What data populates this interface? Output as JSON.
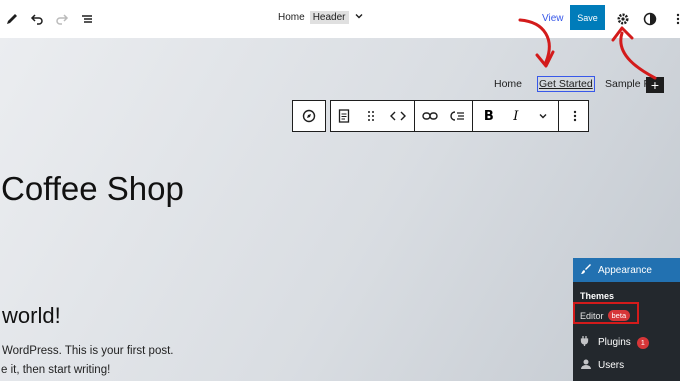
{
  "topbar": {
    "breadcrumb_page": "Home",
    "breadcrumb_template": "Header",
    "view_label": "View",
    "save_label": "Save"
  },
  "navigation": {
    "items": [
      "Home",
      "Get Started",
      "Sample P"
    ],
    "selected_index": 1
  },
  "site": {
    "title": "Coffee Shop"
  },
  "post": {
    "title": "world!",
    "line1": "WordPress. This is your first post.",
    "line2": "e it, then start writing!"
  },
  "admin_menu": {
    "appearance": "Appearance",
    "themes": "Themes",
    "editor": "Editor",
    "editor_badge": "beta",
    "plugins": "Plugins",
    "plugins_count": "1",
    "users": "Users"
  },
  "colors": {
    "accent_blue": "#007cba",
    "admin_dark": "#23282d",
    "admin_highlight": "#2271b1",
    "annotation_red": "#d31b1b"
  }
}
